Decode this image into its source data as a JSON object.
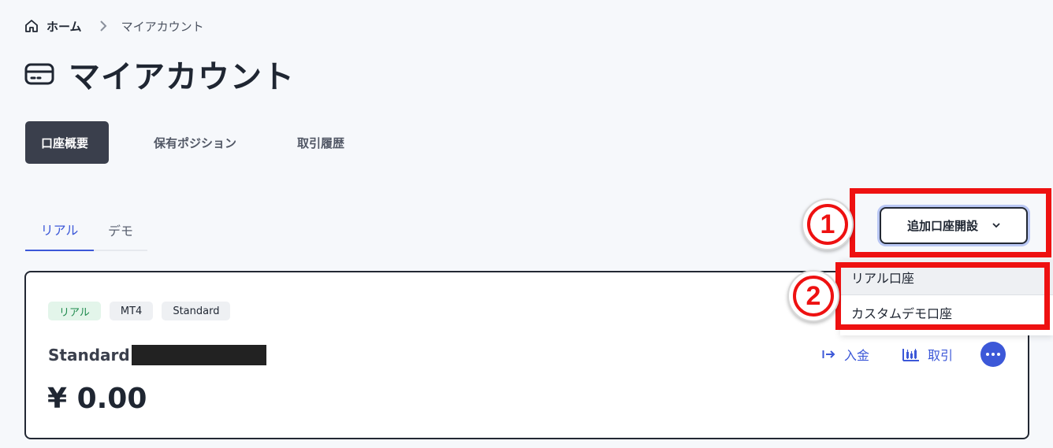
{
  "breadcrumb": {
    "home_label": "ホーム",
    "current_label": "マイアカウント",
    "home_icon": "home-icon",
    "separator_icon": "chevron-right-icon"
  },
  "page": {
    "title": "マイアカウント",
    "title_icon": "credit-card-icon"
  },
  "main_tabs": [
    {
      "label": "口座概要",
      "active": true
    },
    {
      "label": "保有ポジション",
      "active": false
    },
    {
      "label": "取引履歴",
      "active": false
    }
  ],
  "sub_tabs": [
    {
      "label": "リアル",
      "active": true
    },
    {
      "label": "デモ",
      "active": false
    }
  ],
  "open_account": {
    "label": "追加口座開設",
    "icon": "chevron-down-icon",
    "menu": [
      {
        "label": "リアル口座"
      },
      {
        "label": "カスタムデモ口座"
      }
    ]
  },
  "account_card": {
    "badges": [
      "リアル",
      "MT4",
      "Standard"
    ],
    "name": "Standard",
    "balance": "¥ 0.00",
    "actions": {
      "deposit_label": "入金",
      "deposit_icon": "arrow-right-to-bar-icon",
      "trade_label": "取引",
      "trade_icon": "candlestick-chart-icon",
      "more_icon": "more-dots-icon"
    }
  },
  "annotations": {
    "step1": "1",
    "step2": "2"
  },
  "colors": {
    "accent": "#3c58d8",
    "annotation_red": "#ee1111",
    "active_tab_bg": "#3a3f4c",
    "badge_real_bg": "#e3f5ea"
  }
}
